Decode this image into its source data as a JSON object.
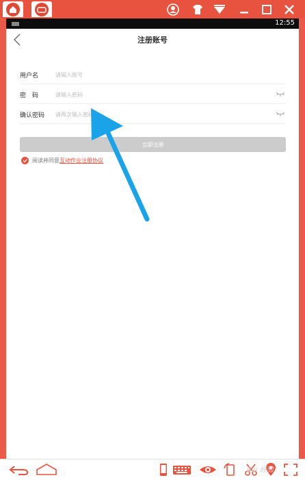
{
  "status_bar": {
    "time": "12:55"
  },
  "header": {
    "title": "注册账号"
  },
  "form": {
    "username": {
      "label": "用户名",
      "placeholder": "请输入账号"
    },
    "password": {
      "label": "密　码",
      "placeholder": "请输入密码"
    },
    "confirm": {
      "label": "确认密码",
      "placeholder": "请再次输入密码"
    }
  },
  "submit_label": "立即注册",
  "agreement": {
    "prefix": "阅读并同意",
    "link": "互动作业注册协议"
  },
  "watermark": "Bai 经验",
  "colors": {
    "brand": "#e8533f",
    "button_disabled": "#cccccc",
    "arrow": "#1aa3e8"
  },
  "icons": [
    "home-icon",
    "tab-app-icon",
    "user-icon",
    "shirt-icon",
    "wifi-icon",
    "minimize-icon",
    "maximize-icon",
    "close-icon",
    "back-chevron-icon",
    "eye-hidden-icon",
    "checkmark-icon",
    "back-icon",
    "home-outline-icon",
    "phone-icon",
    "keyboard-icon",
    "eye-icon",
    "rotate-icon",
    "scissors-icon",
    "location-icon",
    "fullscreen-icon"
  ]
}
